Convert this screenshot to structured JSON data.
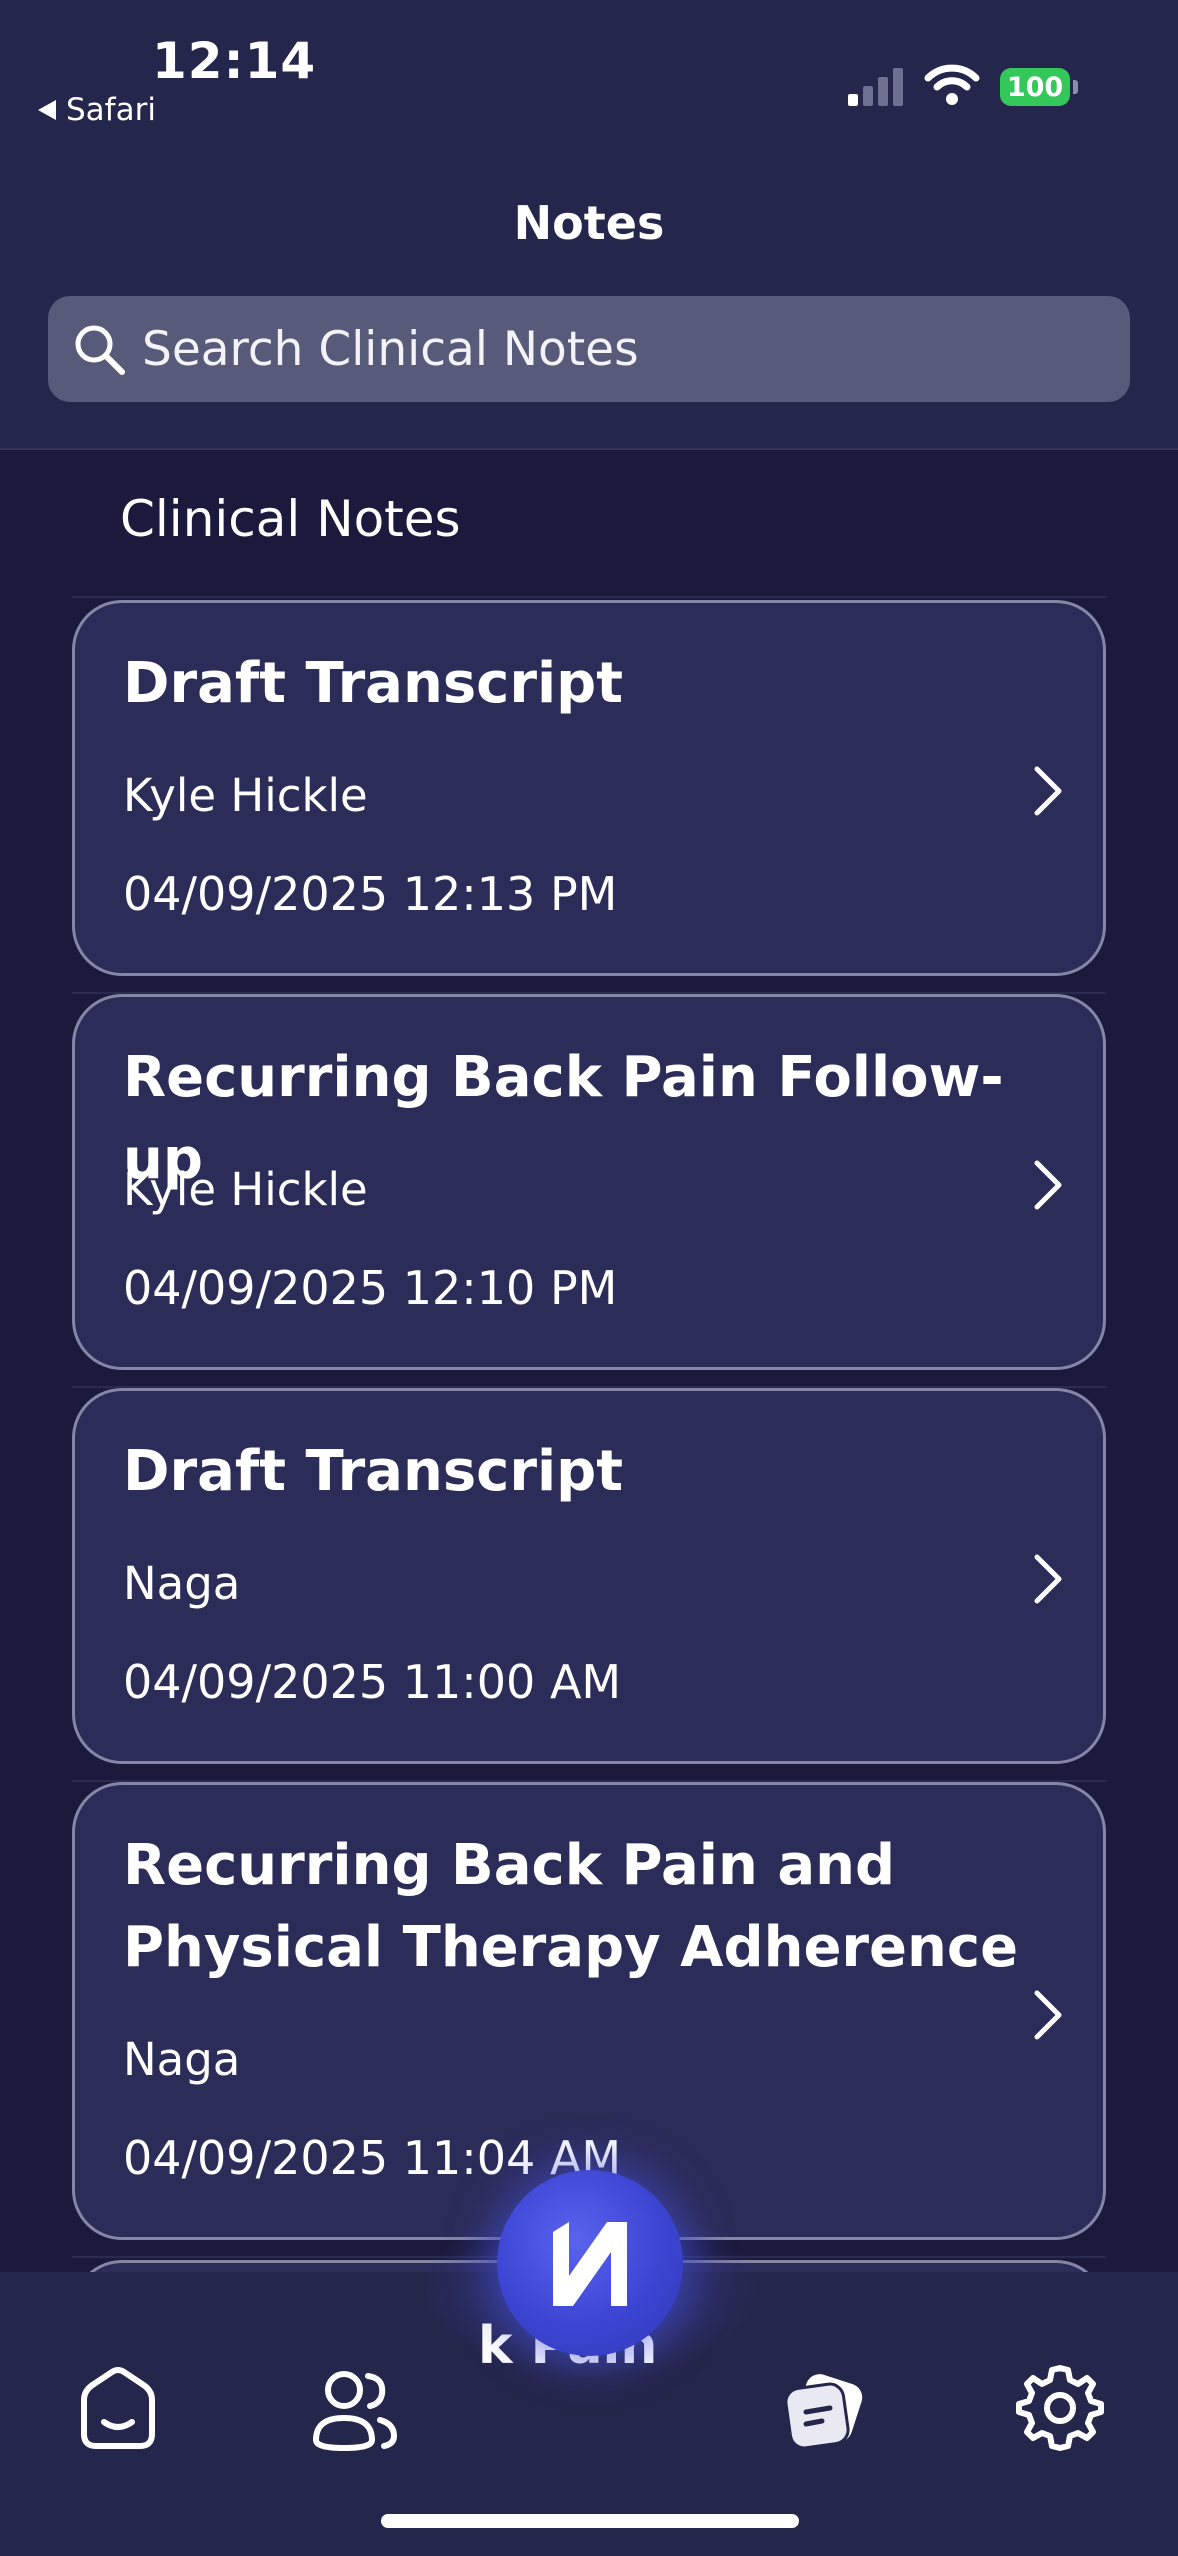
{
  "status_bar": {
    "time": "12:14",
    "back_app": "Safari",
    "battery": "100"
  },
  "header": {
    "title": "Notes"
  },
  "search": {
    "placeholder": "Search Clinical Notes"
  },
  "section": {
    "title": "Clinical Notes"
  },
  "notes": [
    {
      "title": "Draft Transcript",
      "author": "Kyle Hickle",
      "date": "04/09/2025 12:13 PM"
    },
    {
      "title": "Recurring Back Pain Follow-up",
      "author": "Kyle Hickle",
      "date": "04/09/2025 12:10 PM"
    },
    {
      "title": "Draft Transcript",
      "author": "Naga",
      "date": "04/09/2025 11:00 AM"
    },
    {
      "title": "Recurring Back Pain and Physical Therapy Adherence",
      "author": "Naga",
      "date": "04/09/2025 11:04 AM"
    }
  ],
  "peek_text": "k Pain",
  "tabbar": {
    "tabs": [
      {
        "icon": "home-icon"
      },
      {
        "icon": "patients-icon"
      },
      {
        "icon": "notes-icon"
      },
      {
        "icon": "settings-icon"
      }
    ],
    "fab_icon": "logo-n-icon"
  },
  "colors": {
    "background": "#1b1a3d",
    "header": "#25264c",
    "card": "#2c2c59",
    "card_border": "#8586a6",
    "search_field": "#585a7a",
    "battery": "#34c759",
    "fab": "#3c45d2"
  }
}
